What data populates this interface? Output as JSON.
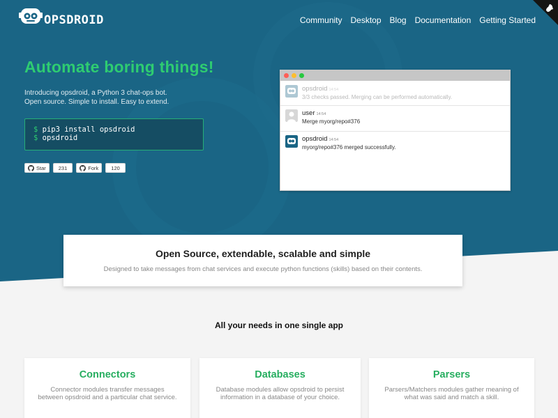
{
  "brand": {
    "name": "OPSDROID"
  },
  "nav": {
    "links": [
      "Community",
      "Desktop",
      "Blog",
      "Documentation",
      "Getting Started"
    ]
  },
  "hero": {
    "headline": "Automate boring things!",
    "intro_line1": "Introducing opsdroid, a Python 3 chat-ops bot.",
    "intro_line2": "Open source. Simple to install. Easy to extend.",
    "code": [
      {
        "prompt": "$",
        "cmd": "pip3 install opsdroid"
      },
      {
        "prompt": "$",
        "cmd": "opsdroid"
      }
    ],
    "github": {
      "star_label": "Star",
      "star_count": "231",
      "fork_label": "Fork",
      "fork_count": "120"
    }
  },
  "chat": {
    "messages": [
      {
        "user": "opsdroid",
        "time": "14:54",
        "text": "3/3 checks passed. Merging can be performed automatically."
      },
      {
        "user": "user",
        "time": "14:54",
        "text": "Merge myorg/repo#376"
      },
      {
        "user": "opsdroid",
        "time": "14:54",
        "text": "myorg/repo#376 merged successfully."
      }
    ]
  },
  "feature": {
    "title": "Open Source, extendable, scalable and simple",
    "subtitle": "Designed to take messages from chat services and execute python functions (skills) based on their contents."
  },
  "section": {
    "title": "All your needs in one single app"
  },
  "cards": [
    {
      "title": "Connectors",
      "desc": "Connector modules transfer messages between opsdroid and a particular chat service."
    },
    {
      "title": "Databases",
      "desc": "Database modules allow opsdroid to persist information in a database of your choice."
    },
    {
      "title": "Parsers",
      "desc": "Parsers/Matchers modules gather meaning of what was said and match a skill."
    }
  ],
  "colors": {
    "hero_bg": "#1a6585",
    "accent": "#2ecc71",
    "page_bg": "#f4f4f4"
  }
}
